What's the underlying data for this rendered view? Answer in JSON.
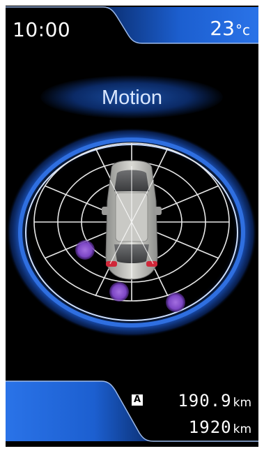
{
  "header": {
    "time": "10:00",
    "temperature_value": "23",
    "temperature_unit": "°c"
  },
  "mode": {
    "label": "Motion"
  },
  "sensor_display": {
    "vehicle": "car-top-view-icon",
    "detected_objects": 3,
    "object_color": "#8a4fc9",
    "ring_color": "#2f6fe0"
  },
  "trip": {
    "mode_letter": "A",
    "trip_distance": "190.9",
    "trip_unit": "km",
    "odometer": "1920",
    "odometer_unit": "km"
  },
  "colors": {
    "accent_blue": "#1d63d6",
    "background": "#000000"
  }
}
